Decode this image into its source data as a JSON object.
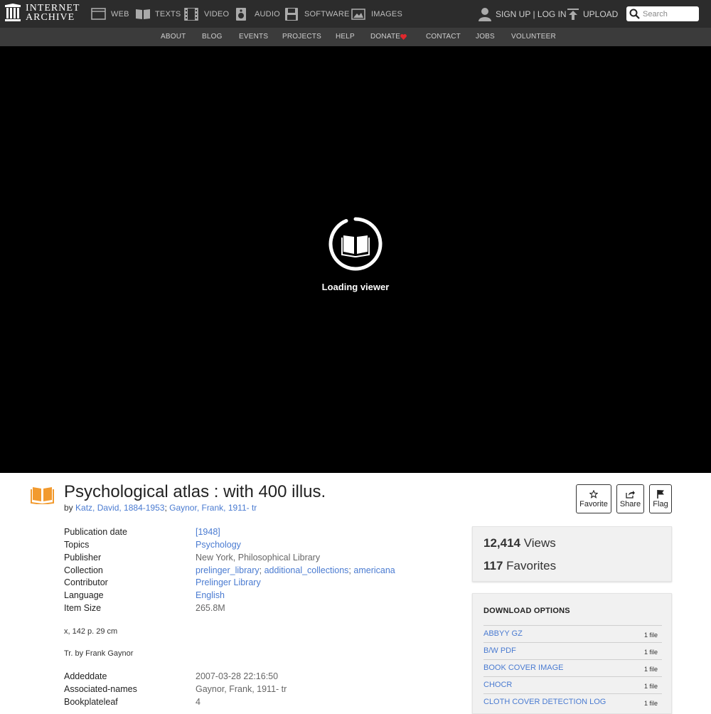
{
  "topbar": {
    "logo_line1": "INTERNET",
    "logo_line2": "ARCHIVE",
    "nav": [
      {
        "label": "WEB",
        "icon": "web-icon"
      },
      {
        "label": "TEXTS",
        "icon": "texts-icon"
      },
      {
        "label": "VIDEO",
        "icon": "video-icon"
      },
      {
        "label": "AUDIO",
        "icon": "audio-icon"
      },
      {
        "label": "SOFTWARE",
        "icon": "software-icon"
      },
      {
        "label": "IMAGES",
        "icon": "images-icon"
      }
    ],
    "signup_login": "SIGN UP | LOG IN",
    "upload": "UPLOAD",
    "search_placeholder": "Search"
  },
  "subnav": [
    "ABOUT",
    "BLOG",
    "EVENTS",
    "PROJECTS",
    "HELP",
    "DONATE",
    "CONTACT",
    "JOBS",
    "VOLUNTEER"
  ],
  "viewer": {
    "loading_text": "Loading viewer"
  },
  "item": {
    "title": "Psychological atlas : with 400 illus.",
    "by_prefix": "by",
    "authors": [
      "Katz, David, 1884-1953",
      "Gaynor, Frank, 1911- tr"
    ],
    "actions": {
      "favorite": "Favorite",
      "share": "Share",
      "flag": "Flag"
    }
  },
  "metadata": {
    "publication_date": {
      "key": "Publication date",
      "value": "[1948]"
    },
    "topics": {
      "key": "Topics",
      "value": "Psychology"
    },
    "publisher": {
      "key": "Publisher",
      "value": "New York, Philosophical Library"
    },
    "collection": {
      "key": "Collection",
      "values": [
        "prelinger_library",
        "additional_collections",
        "americana"
      ]
    },
    "contributor": {
      "key": "Contributor",
      "value": "Prelinger Library"
    },
    "language": {
      "key": "Language",
      "value": "English"
    },
    "item_size": {
      "key": "Item Size",
      "value": "265.8M"
    },
    "note1": "x, 142 p. 29 cm",
    "note2": "Tr. by Frank Gaynor",
    "addeddate": {
      "key": "Addeddate",
      "value": "2007-03-28 22:16:50"
    },
    "associated_names": {
      "key": "Associated-names",
      "value": "Gaynor, Frank, 1911- tr"
    },
    "bookplateleaf": {
      "key": "Bookplateleaf",
      "value": "4"
    }
  },
  "stats": {
    "views_count": "12,414",
    "views_label": "Views",
    "favorites_count": "117",
    "favorites_label": "Favorites"
  },
  "downloads": {
    "title": "DOWNLOAD OPTIONS",
    "items": [
      {
        "label": "ABBYY GZ",
        "count": "1 file"
      },
      {
        "label": "B/W PDF",
        "count": "1 file"
      },
      {
        "label": "BOOK COVER IMAGE",
        "count": "1 file"
      },
      {
        "label": "CHOCR",
        "count": "1 file"
      },
      {
        "label": "CLOTH COVER DETECTION LOG",
        "count": "1 file"
      }
    ]
  },
  "colors": {
    "link": "#4a7bd1",
    "topbar": "#2c2c2c",
    "subnav": "#3b3b3b",
    "donate_heart": "#e0282d",
    "texts_icon": "#f29a2e"
  }
}
